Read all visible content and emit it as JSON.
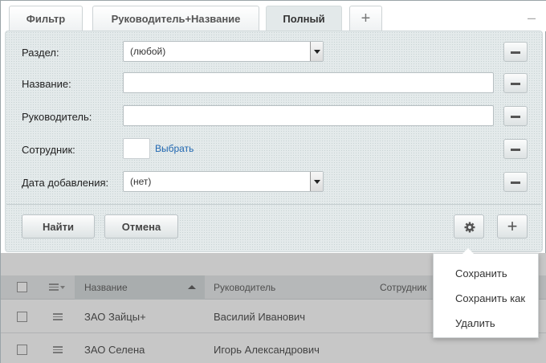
{
  "tabs": [
    {
      "label": "Фильтр"
    },
    {
      "label": "Руководитель+Название"
    },
    {
      "label": "Полный"
    },
    {
      "label": "+"
    }
  ],
  "collapse_label": "–",
  "filter": {
    "section": {
      "label": "Раздел:",
      "value": "(любой)"
    },
    "name": {
      "label": "Название:",
      "value": ""
    },
    "manager": {
      "label": "Руководитель:",
      "value": ""
    },
    "employee": {
      "label": "Сотрудник:",
      "choose": "Выбрать"
    },
    "date": {
      "label": "Дата добавления:",
      "value": "(нет)"
    }
  },
  "buttons": {
    "find": "Найти",
    "cancel": "Отмена",
    "add": "+"
  },
  "table": {
    "headers": {
      "name": "Название",
      "manager": "Руководитель",
      "employee": "Сотрудник"
    },
    "rows": [
      {
        "name": "ЗАО Зайцы+",
        "manager": "Василий Иванович"
      },
      {
        "name": "ЗАО Селена",
        "manager": "Игорь Александрович"
      }
    ]
  },
  "popup_menu": {
    "items": [
      "Сохранить",
      "Сохранить как",
      "Удалить"
    ]
  },
  "icons": {
    "settings": "gear-icon",
    "add": "plus-icon",
    "remove": "minus-icon"
  }
}
